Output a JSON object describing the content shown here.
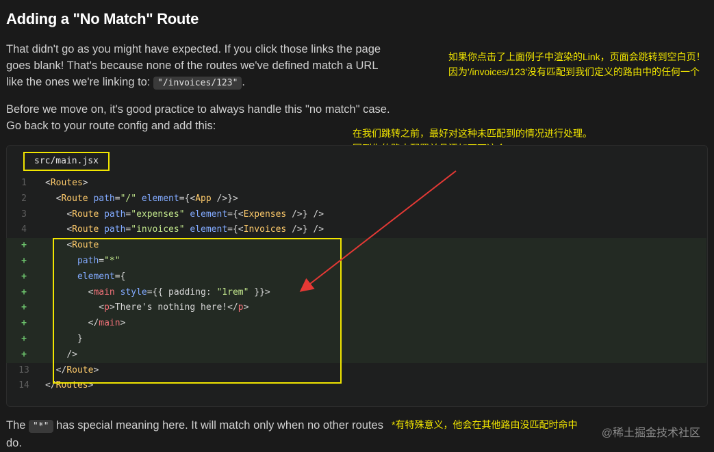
{
  "heading": "Adding a \"No Match\" Route",
  "para1": {
    "text_before": "That didn't go as you might have expected. If you click those links the page goes blank! That's because none of the routes we've defined match a URL like the ones we're linking to: ",
    "code": "\"/invoices/123\"",
    "text_after": "."
  },
  "para2": "Before we move on, it's good practice to always handle this \"no match\" case. Go back to your route config and add this:",
  "notes": {
    "note1": "如果你点击了上面例子中渲染的Link，页面会跳转到空白页！因为'/invoices/123'没有匹配到我们定义的路由中的任何一个",
    "note2_line1": "在我们跳转之前，最好对这种未匹配到的情况进行处理。",
    "note2_line2": "回到你的路由配置并且添加下面这个",
    "note3": "*有特殊意义，他会在其他路由没匹配时命中"
  },
  "code_block": {
    "filename": "src/main.jsx",
    "gutter": [
      "1",
      "2",
      "3",
      "4",
      "+",
      "+",
      "+",
      "+",
      "+",
      "+",
      "+",
      "+",
      "13",
      "14"
    ]
  },
  "para3": {
    "text_before": "The ",
    "code": "\"*\"",
    "text_after": " has special meaning here. It will match only when no other routes do."
  },
  "watermark": "@稀土掘金技术社区",
  "colors": {
    "highlight": "#f2e600",
    "arrow": "#e53935",
    "added_bg": "#232a23"
  }
}
